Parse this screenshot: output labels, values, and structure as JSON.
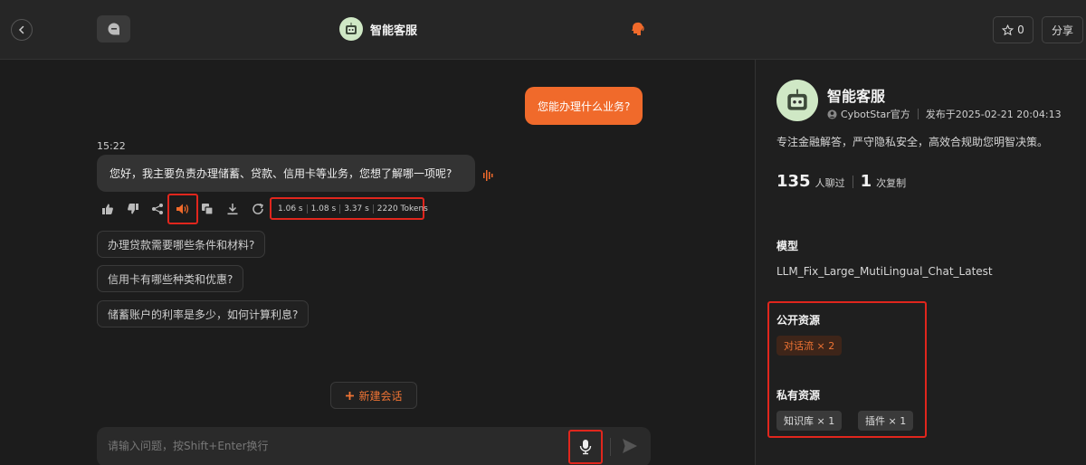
{
  "header": {
    "title": "智能客服",
    "star_count": "0",
    "share_label": "分享"
  },
  "chat": {
    "user_message": "您能办理什么业务?",
    "timestamp": "15:22",
    "bot_message": "您好，我主要负责办理储蓄、贷款、信用卡等业务，您想了解哪一项呢?",
    "stats": [
      "1.06 s",
      "1.08 s",
      "3.37 s",
      "2220 Tokens"
    ],
    "suggestions": [
      "办理贷款需要哪些条件和材料?",
      "信用卡有哪些种类和优惠?",
      "储蓄账户的利率是多少，如何计算利息?"
    ],
    "new_chat_label": "新建会话",
    "input_placeholder": "请输入问题，按Shift+Enter换行"
  },
  "panel": {
    "name": "智能客服",
    "author": "CybotStar官方",
    "published": "发布于2025-02-21 20:04:13",
    "description": "专注金融解答，严守隐私安全，高效合规助您明智决策。",
    "chat_count": "135",
    "chat_count_label": "人聊过",
    "copy_count": "1",
    "copy_count_label": "次复制",
    "model_label": "模型",
    "model_name": "LLM_Fix_Large_MutiLingual_Chat_Latest",
    "public_label": "公开资源",
    "public_tags": [
      "对话流 × 2"
    ],
    "private_label": "私有资源",
    "private_tags": [
      "知识库 × 1",
      "插件 × 1"
    ]
  },
  "colors": {
    "accent": "#f06a2b",
    "highlight": "#e0261d"
  }
}
